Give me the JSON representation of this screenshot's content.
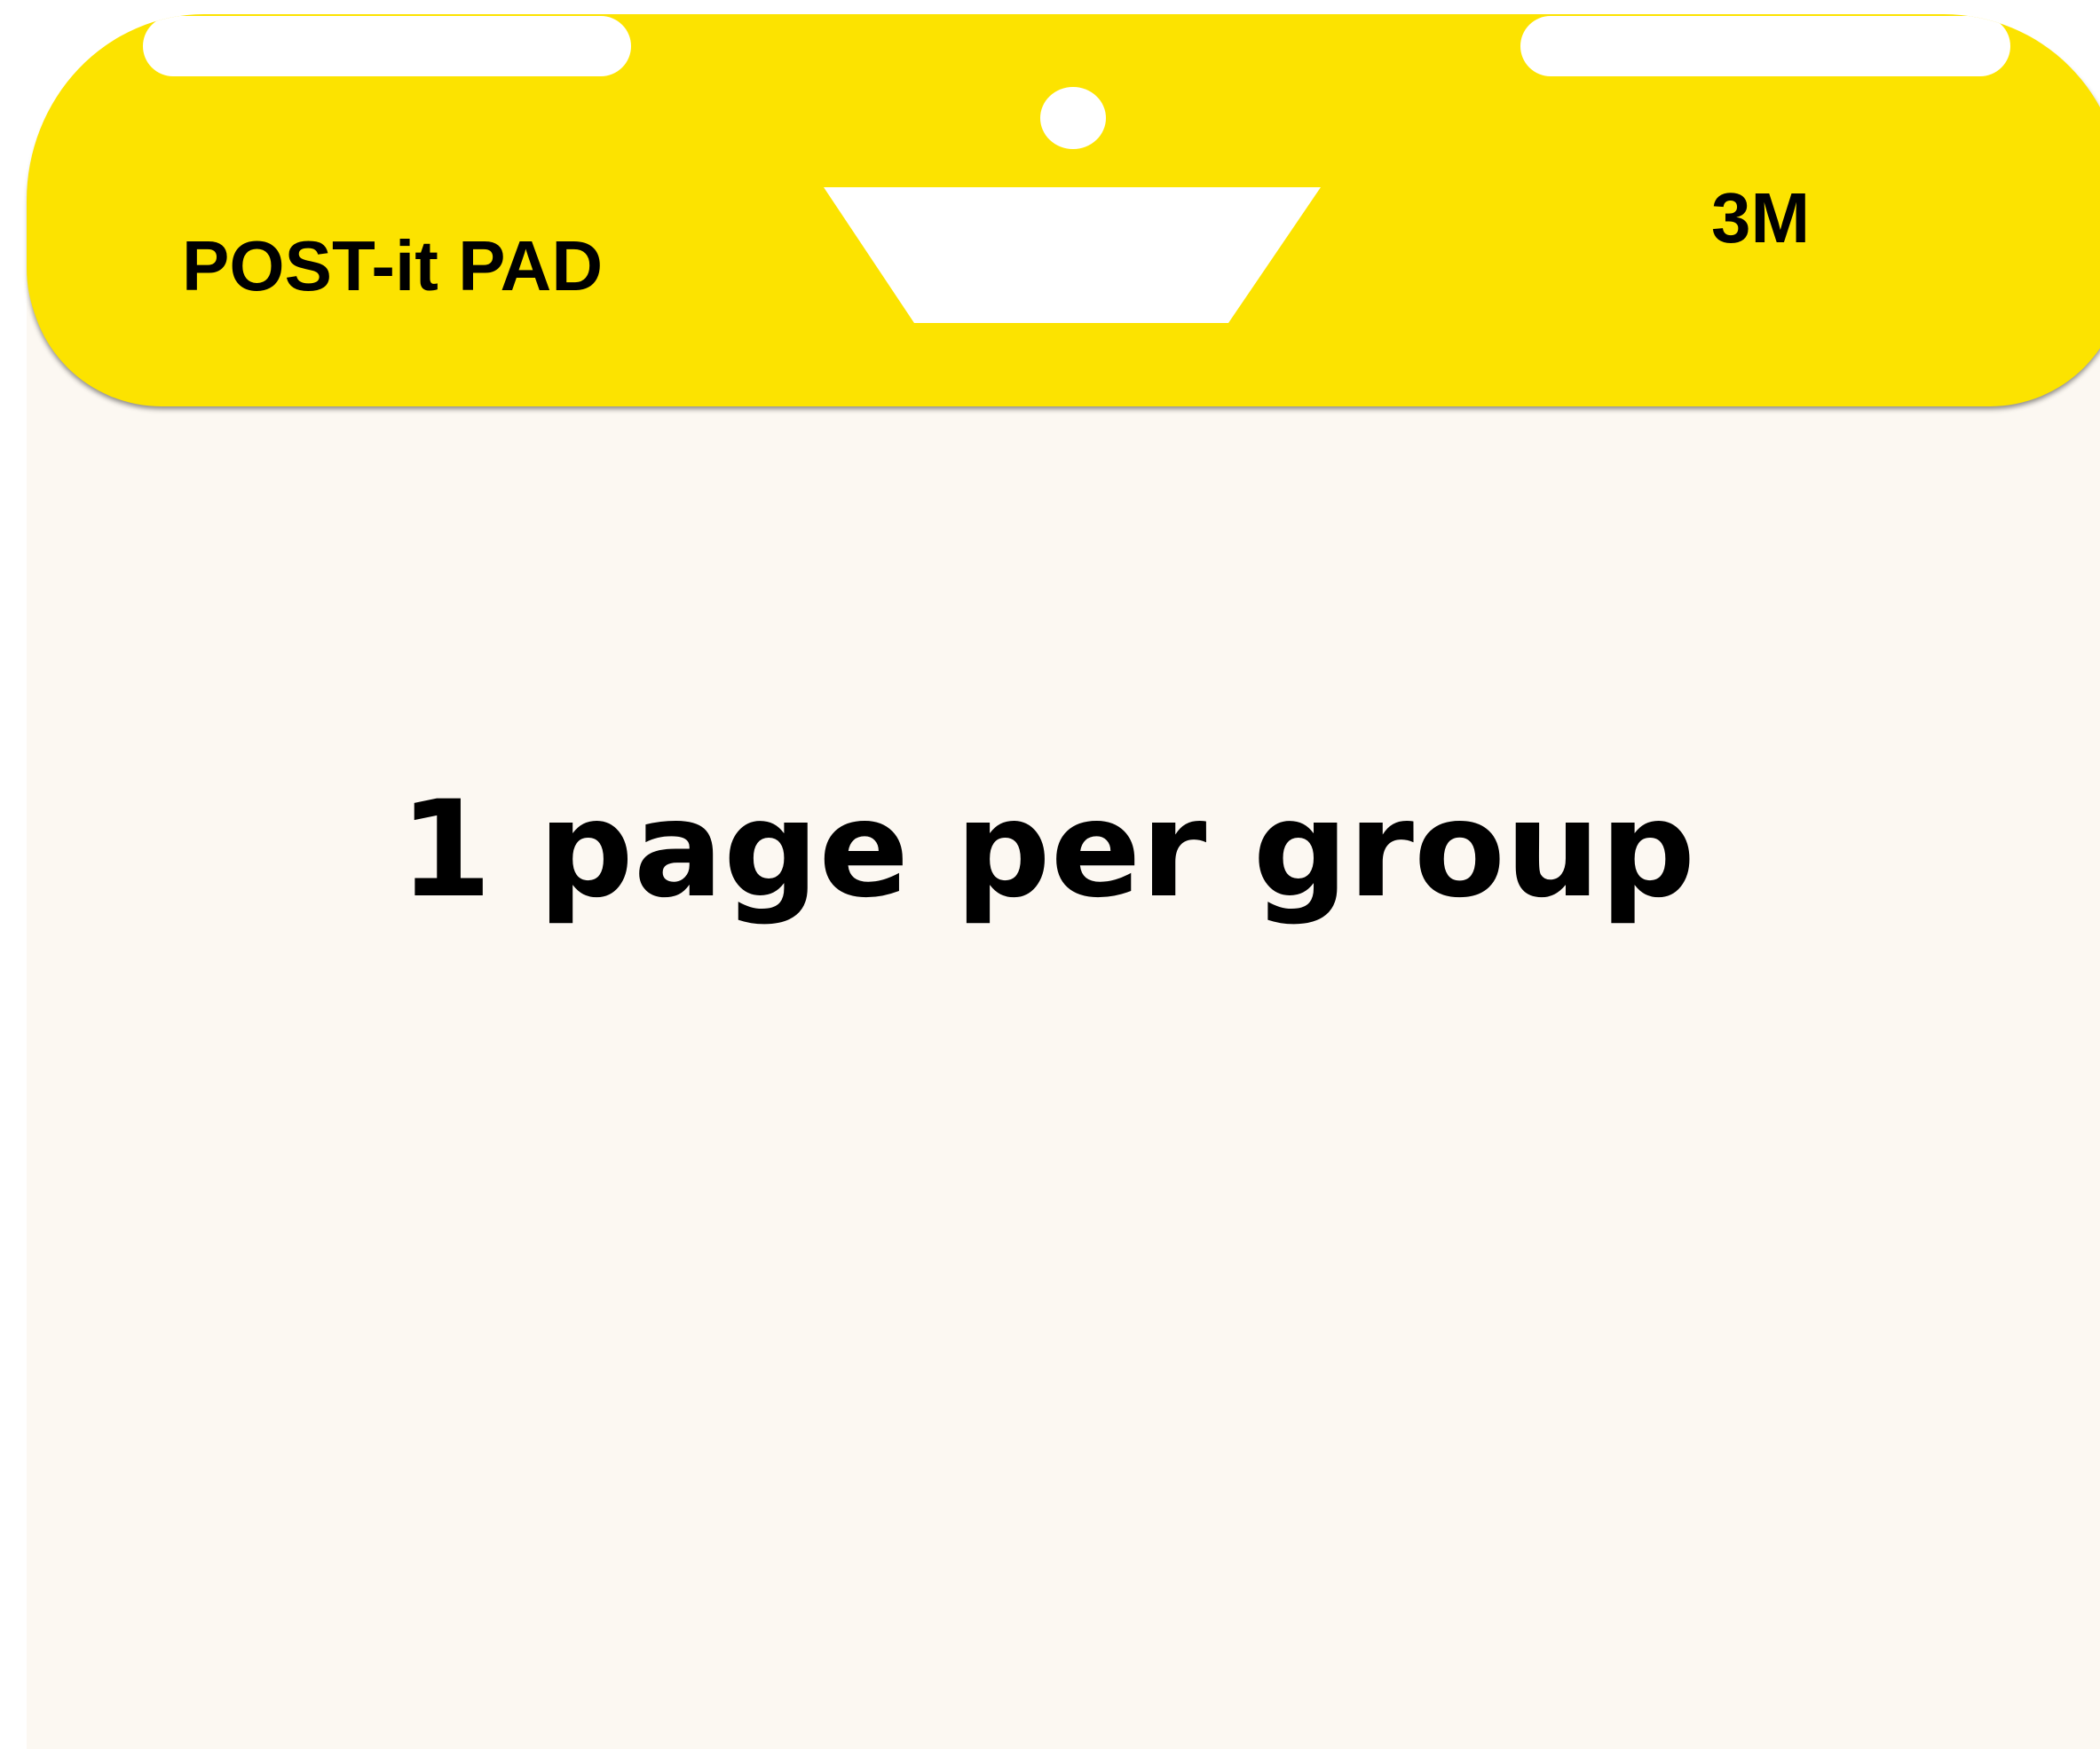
{
  "pad": {
    "label": "POST-it PAD",
    "maker": "3M",
    "sheet_text": "1 page per group"
  },
  "colors": {
    "header": "#fce300",
    "sheet": "#fcf8f2",
    "text": "#000000",
    "cutout": "#ffffff"
  }
}
